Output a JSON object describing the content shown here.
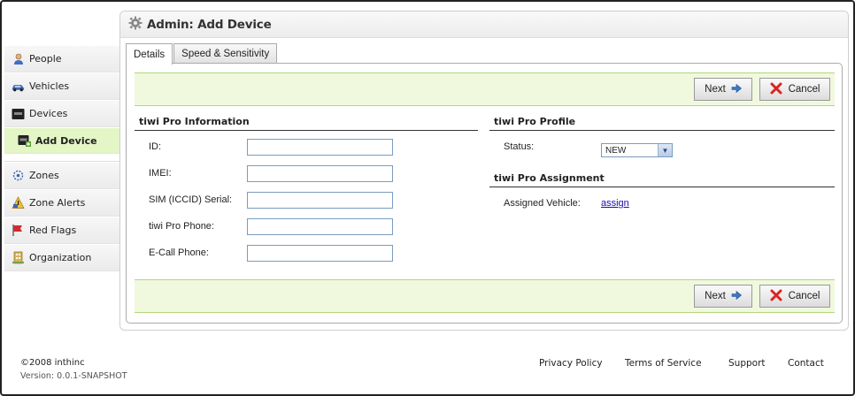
{
  "header": {
    "title": "Admin: Add Device",
    "icon": "gear-icon"
  },
  "sidebar": {
    "items": [
      {
        "label": "People",
        "icon": "person-icon"
      },
      {
        "label": "Vehicles",
        "icon": "car-icon"
      },
      {
        "label": "Devices",
        "icon": "device-icon"
      },
      {
        "label": "Add Device",
        "icon": "add-device-icon"
      },
      {
        "label": "Zones",
        "icon": "zones-icon"
      },
      {
        "label": "Zone Alerts",
        "icon": "warning-icon"
      },
      {
        "label": "Red Flags",
        "icon": "red-flag-icon"
      },
      {
        "label": "Organization",
        "icon": "organization-icon"
      }
    ]
  },
  "tabs": [
    {
      "label": "Details",
      "active": true
    },
    {
      "label": "Speed & Sensitivity",
      "active": false
    }
  ],
  "buttons": {
    "next": "Next",
    "cancel": "Cancel"
  },
  "info": {
    "title": "tiwi Pro Information",
    "fields": [
      {
        "label": "ID:",
        "value": ""
      },
      {
        "label": "IMEI:",
        "value": ""
      },
      {
        "label": "SIM (ICCID) Serial:",
        "value": ""
      },
      {
        "label": "tiwi Pro Phone:",
        "value": ""
      },
      {
        "label": "E-Call Phone:",
        "value": ""
      }
    ]
  },
  "profile": {
    "title": "tiwi Pro Profile",
    "status_label": "Status:",
    "status_value": "NEW"
  },
  "assignment": {
    "title": "tiwi Pro Assignment",
    "vehicle_label": "Assigned Vehicle:",
    "vehicle_link": "assign"
  },
  "footer": {
    "copyright": "©2008 inthinc",
    "version": "Version: 0.0.1-SNAPSHOT",
    "links": [
      "Privacy Policy",
      "Terms of Service",
      "Support",
      "Contact"
    ]
  },
  "colors": {
    "accent_bar": "#f0f9de",
    "accent_border": "#b3d57c",
    "selected_nav": "#e4f5c6"
  }
}
